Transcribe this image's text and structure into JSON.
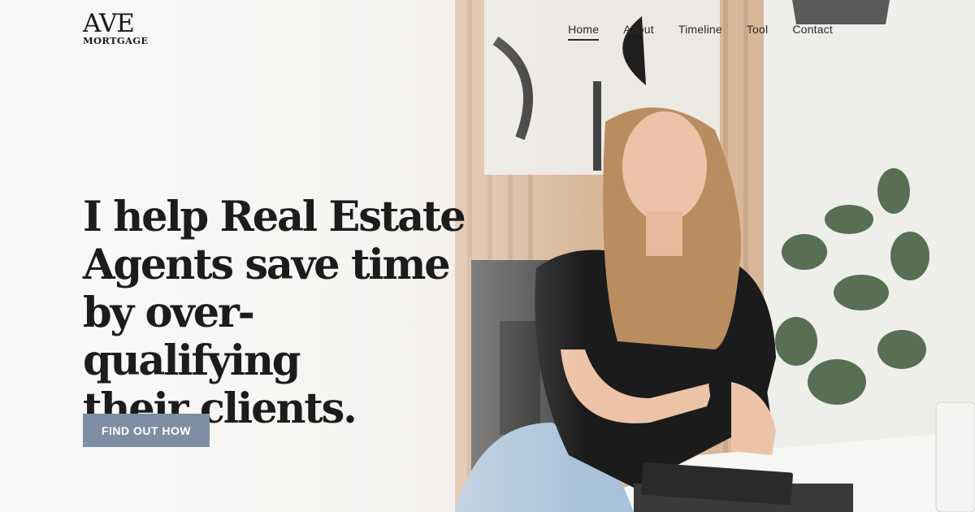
{
  "logo": {
    "top": "AVE",
    "bottom": "MORTGAGE"
  },
  "nav": [
    {
      "label": "Home",
      "active": true
    },
    {
      "label": "About",
      "active": false
    },
    {
      "label": "Timeline",
      "active": false
    },
    {
      "label": "Tool",
      "active": false
    },
    {
      "label": "Contact",
      "active": false
    }
  ],
  "hero": {
    "headline_lines": [
      "I help Real Estate",
      "Agents save time",
      "by over-qualifying",
      "their clients."
    ],
    "cta_label": "FIND OUT HOW"
  },
  "colors": {
    "cta": "#7d8ea3",
    "text": "#1c1c1c"
  }
}
